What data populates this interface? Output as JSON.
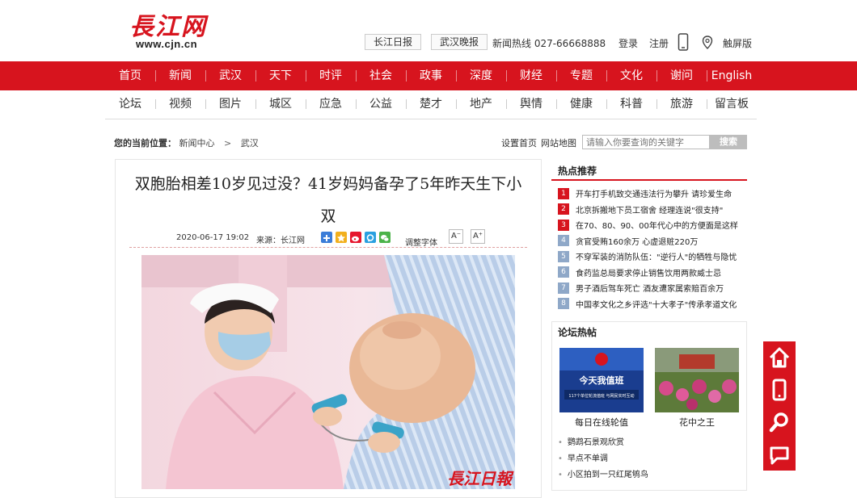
{
  "header": {
    "logo_text": "長江网",
    "logo_url": "www.cjn.cn",
    "link_daily": "长江日报",
    "link_evening": "武汉晚报",
    "hotline": "新闻热线 027-66668888",
    "login": "登录",
    "register": "注册",
    "touch_version": "触屏版"
  },
  "nav_primary": [
    "首页",
    "新闻",
    "武汉",
    "天下",
    "时评",
    "社会",
    "政事",
    "深度",
    "财经",
    "专题",
    "文化",
    "谢问",
    "English"
  ],
  "nav_secondary": [
    "论坛",
    "视频",
    "图片",
    "城区",
    "应急",
    "公益",
    "楚才",
    "地产",
    "舆情",
    "健康",
    "科普",
    "旅游",
    "留言板"
  ],
  "breadcrumb": {
    "label": "您的当前位置：",
    "level1": "新闻中心",
    "separator": ">",
    "level2": "武汉"
  },
  "toplinks": {
    "set_home": "设置首页",
    "sitemap": "网站地图"
  },
  "search": {
    "placeholder": "请输入你要查询的关键字",
    "button": "搜索"
  },
  "article": {
    "title": "双胞胎相差10岁见过没？41岁妈妈备孕了5年昨天生下小双",
    "datetime": "2020-06-17 19:02",
    "source": "来源：长江网",
    "font_adjust": "调整字体",
    "font_smaller": "A⁻",
    "font_larger": "A⁺",
    "watermark": "長江日報"
  },
  "hot": {
    "title": "热点推荐",
    "items": [
      "开车打手机致交通违法行为攀升 请珍爱生命",
      "北京拆搬地下员工宿舍 经理连说\"很支持\"",
      "在70、80、90、00年代心中的方便面是这样",
      "贪官受贿160余万 心虚退赃220万",
      "不穿军装的消防队伍：\"逆行人\"的牺牲与隐忧",
      "食药监总局要求停止销售饮用两款威士忌",
      "男子酒后驾车死亡 酒友遭家属索赔百余万",
      "中国孝文化之乡评选\"十大孝子\"传承孝道文化"
    ],
    "num_colors": [
      "#d7141e",
      "#d7141e",
      "#d7141e",
      "#8fa8c8",
      "#8fa8c8",
      "#8fa8c8",
      "#8fa8c8",
      "#8fa8c8"
    ]
  },
  "forum": {
    "title": "论坛热帖",
    "thumb1_caption": "每日在线轮值",
    "thumb1_text": "今天我值班",
    "thumb1_sub": "117个单位轮流值班 与网民实时互动",
    "thumb2_caption": "花中之王",
    "list": [
      "鹦鹉石景观欣赏",
      "早点不单调",
      "小区拍到一只红尾鸲鸟"
    ]
  },
  "floatbar": {
    "icons": [
      "home-icon",
      "mobile-icon",
      "search-icon",
      "chat-icon"
    ]
  },
  "colors": {
    "brand_red": "#d7141e"
  }
}
